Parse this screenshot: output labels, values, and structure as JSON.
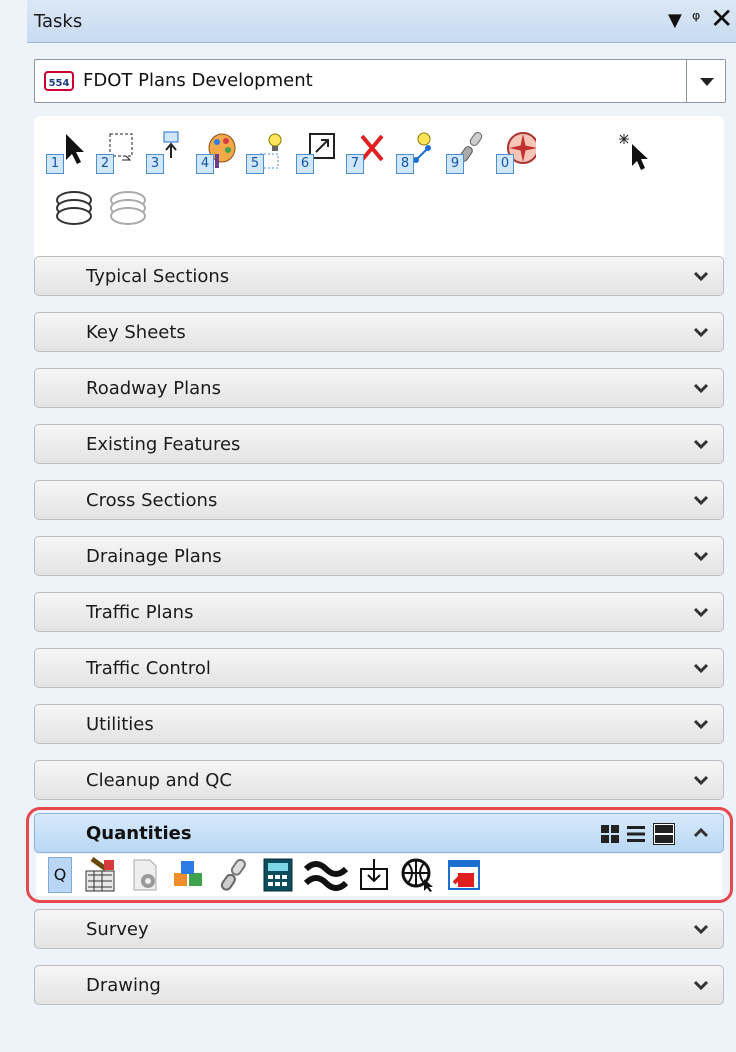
{
  "window": {
    "title": "Tasks",
    "controls": [
      "menu-arrow",
      "pin",
      "close"
    ]
  },
  "workflow": {
    "selected": "FDOT Plans Development",
    "icon": "fdot-shield-icon"
  },
  "toolbox": {
    "tools": [
      {
        "icon": "select-arrow-icon",
        "num": "1"
      },
      {
        "icon": "fence-select-icon",
        "num": "2"
      },
      {
        "icon": "move-fence-icon",
        "num": "3"
      },
      {
        "icon": "palette-icon",
        "num": "4"
      },
      {
        "icon": "highlight-icon",
        "num": "5"
      },
      {
        "icon": "scale-icon",
        "num": "6"
      },
      {
        "icon": "delete-x-icon",
        "num": "7"
      },
      {
        "icon": "dimension-icon",
        "num": "8"
      },
      {
        "icon": "link-icon",
        "num": "9"
      },
      {
        "icon": "compass-icon",
        "num": "0"
      },
      {
        "icon": "sparkle-select-icon",
        "num": ""
      },
      {
        "icon": "layers-color-icon",
        "num": ""
      },
      {
        "icon": "layers-gray-icon",
        "num": ""
      }
    ]
  },
  "sections": [
    {
      "label": "Typical Sections"
    },
    {
      "label": "Key Sheets"
    },
    {
      "label": "Roadway Plans"
    },
    {
      "label": "Existing Features"
    },
    {
      "label": "Cross Sections"
    },
    {
      "label": "Drainage Plans"
    },
    {
      "label": "Traffic Plans"
    },
    {
      "label": "Traffic Control"
    },
    {
      "label": "Utilities"
    },
    {
      "label": "Cleanup and QC"
    }
  ],
  "quantities": {
    "label": "Quantities",
    "view_modes": [
      "grid-view-icon",
      "list-view-icon",
      "detail-view-icon"
    ],
    "tool_q_label": "Q",
    "tools": [
      "quantity-manager-icon",
      "document-gear-icon",
      "cubes-icon",
      "chain-link-icon",
      "calculator-icon",
      "wave-icon",
      "export-icon",
      "globe-icon",
      "report-icon"
    ]
  },
  "bottom_sections": [
    {
      "label": "Survey"
    },
    {
      "label": "Drawing"
    }
  ],
  "colors": {
    "highlight_ring": "#e5484d",
    "active_header": "#c6def6",
    "title_bar": "#d3e3f5"
  }
}
